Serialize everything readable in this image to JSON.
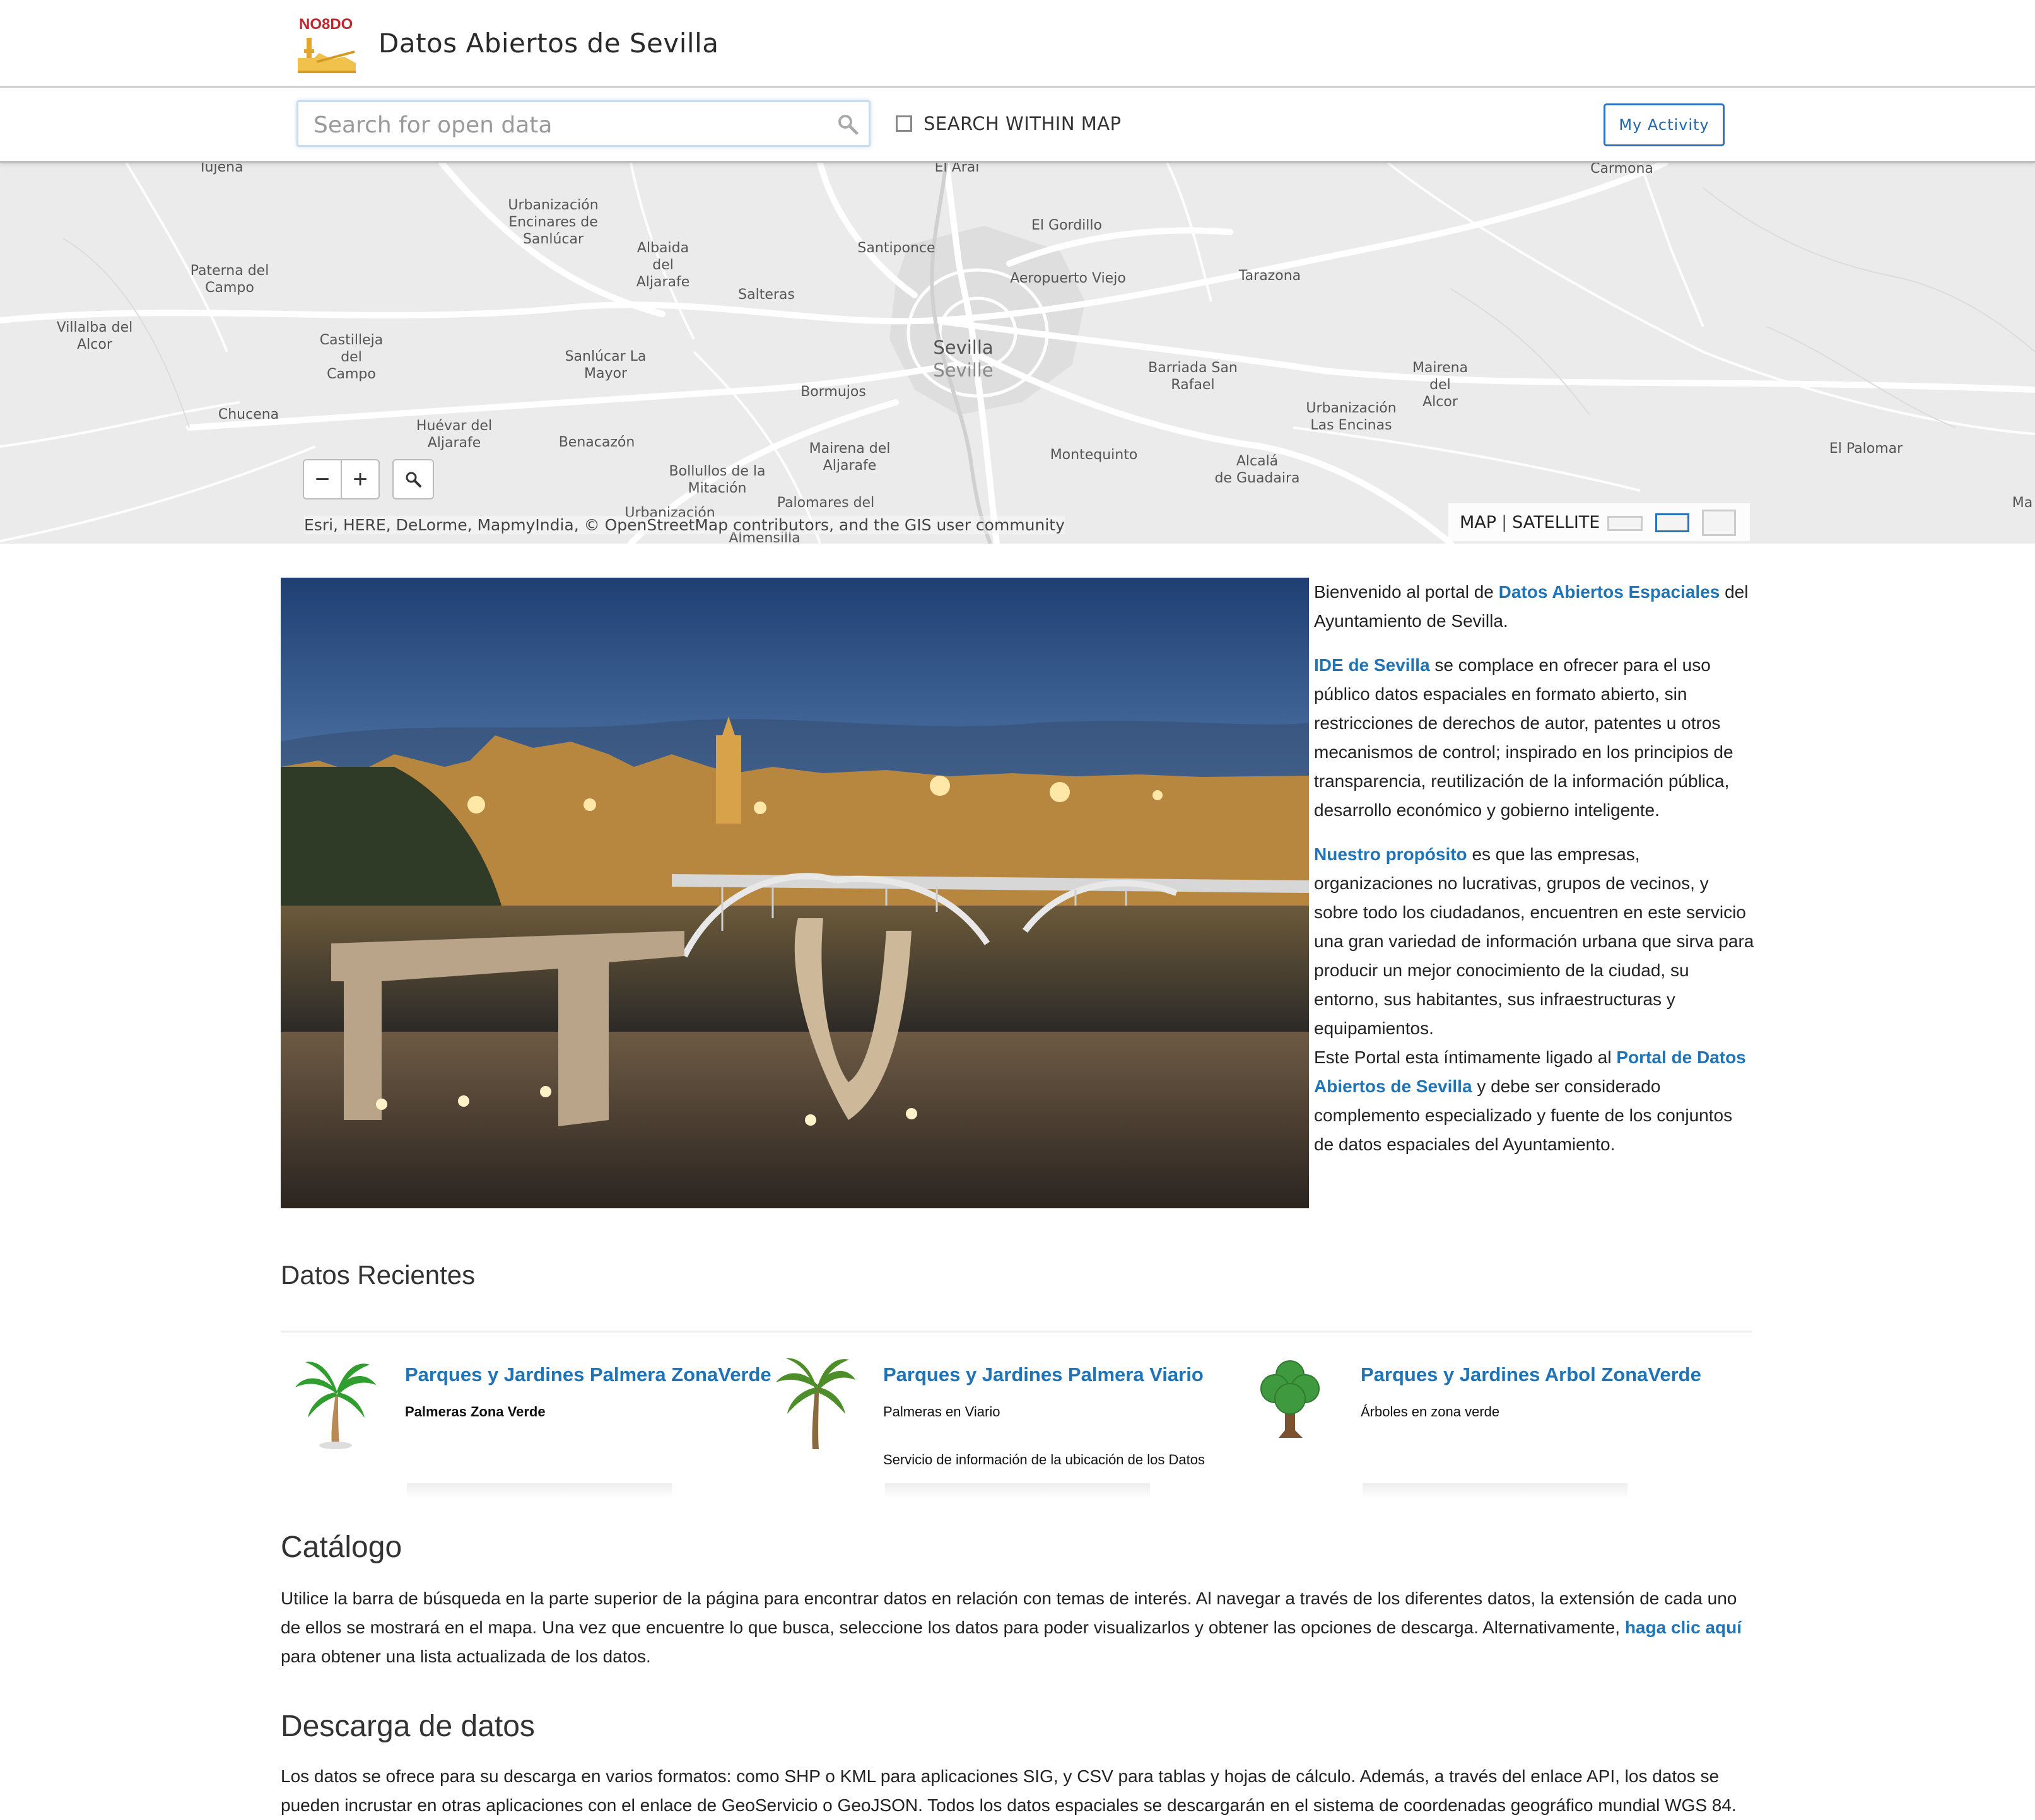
{
  "header": {
    "logo_text": "NO8DO",
    "site_title": "Datos Abiertos de Sevilla"
  },
  "searchbar": {
    "placeholder": "Search for open data",
    "within_map_label": "SEARCH WITHIN MAP",
    "within_map_checked": false,
    "activity_label": "My Activity"
  },
  "map": {
    "labels": [
      "Tujena",
      "Urbanización\nEncinares de\nSanlúcar",
      "El Arai",
      "Carmona",
      "El Gordillo",
      "Albaida\ndel\nAljarafe",
      "Santiponce",
      "Paterna del\nCampo",
      "Aeropuerto Viejo",
      "Tarazona",
      "Salteras",
      "Villalba del\nAlcor",
      "Castilleja\ndel\nCampo",
      "Sanlúcar La\nMayor",
      "Barriada San\nRafael",
      "Mairena\ndel\nAlcor",
      "Bormujos",
      "Urbanización\nLas Encinas",
      "Chucena",
      "Huévar del\nAljarafe",
      "Benacazón",
      "Mairena del\nAljarafe",
      "Montequinto",
      "Alcalá\nde Guadaira",
      "El Palomar",
      "Bollullos de la\nMitación",
      "Urbanización",
      "Palomares del",
      "Almensilla",
      "Ma"
    ],
    "city_label": "Sevilla",
    "city_label_en": "Seville",
    "zoom_out": "−",
    "zoom_in": "+",
    "attribution": "Esri, HERE, DeLorme, MapmyIndia, © OpenStreetMap contributors, and the GIS user community",
    "toggle_map": "MAP",
    "toggle_sep": "|",
    "toggle_satellite": "SATELLITE"
  },
  "intro": {
    "p1_pre": "Bienvenido al portal de ",
    "p1_link": "Datos Abiertos Espaciales",
    "p1_post": " del Ayuntamiento de Sevilla.",
    "p2_link": "IDE de Sevilla",
    "p2_post": " se complace en ofrecer para el uso público datos espaciales en formato abierto, sin restricciones de derechos de autor, patentes u otros mecanismos de control; inspirado en los principios de transparencia, reutilización de la información pública, desarrollo económico y gobierno inteligente.",
    "p3_link": "Nuestro propósito",
    "p3_post": " es que las empresas, organizaciones no lucrativas, grupos de vecinos, y sobre todo los ciudadanos, encuentren en este servicio una gran variedad de información urbana que sirva para producir un mejor conocimiento de la ciudad, su entorno, sus habitantes, sus infraestructuras y equipamientos.",
    "p4_pre": "Este Portal esta íntimamente ligado al ",
    "p4_link": "Portal de Datos Abiertos de Sevilla",
    "p4_post": " y debe ser considerado complemento especializado y fuente de los conjuntos de datos espaciales del Ayuntamiento."
  },
  "recent": {
    "heading": "Datos Recientes",
    "items": [
      {
        "title": "Parques y Jardines Palmera ZonaVerde",
        "subtitle": "Palmeras Zona Verde",
        "description": "",
        "icon": "palm-tree-icon"
      },
      {
        "title": "Parques y Jardines Palmera Viario",
        "subtitle": "Palmeras en Viario",
        "description": "Servicio de información de la ubicación de los Datos",
        "icon": "palm-tree-icon"
      },
      {
        "title": "Parques y Jardines Arbol ZonaVerde",
        "subtitle": "Árboles en zona verde",
        "description": "",
        "icon": "tree-icon"
      }
    ]
  },
  "catalog": {
    "heading": "Catálogo",
    "text_pre": "Utilice la barra de búsqueda en la parte superior de la página para encontrar datos en relación con temas de interés. Al navegar a través de los diferentes datos, la extensión de cada uno de ellos se mostrará en el mapa. Una vez que encuentre lo que busca, seleccione los datos para poder visualizarlos y obtener las opciones de descarga. Alternativamente, ",
    "link": "haga clic aquí",
    "text_post": " para obtener una lista actualizada de los datos."
  },
  "download": {
    "heading": "Descarga de datos",
    "text": "Los datos se ofrece para su descarga en varios formatos: como SHP o KML para aplicaciones SIG, y CSV para tablas y hojas de cálculo. Además, a través del enlace API, los datos se pueden incrustar en otras aplicaciones con el enlace de GeoServicio o GeoJSON. Todos los datos espaciales se descargarán en el sistema de coordenadas geográfico mundial WGS 84."
  },
  "colors": {
    "link": "#1f73b7",
    "map_bg": "#ebebeb",
    "logo_red": "#c0262d",
    "logo_gold": "#e2a62a"
  }
}
